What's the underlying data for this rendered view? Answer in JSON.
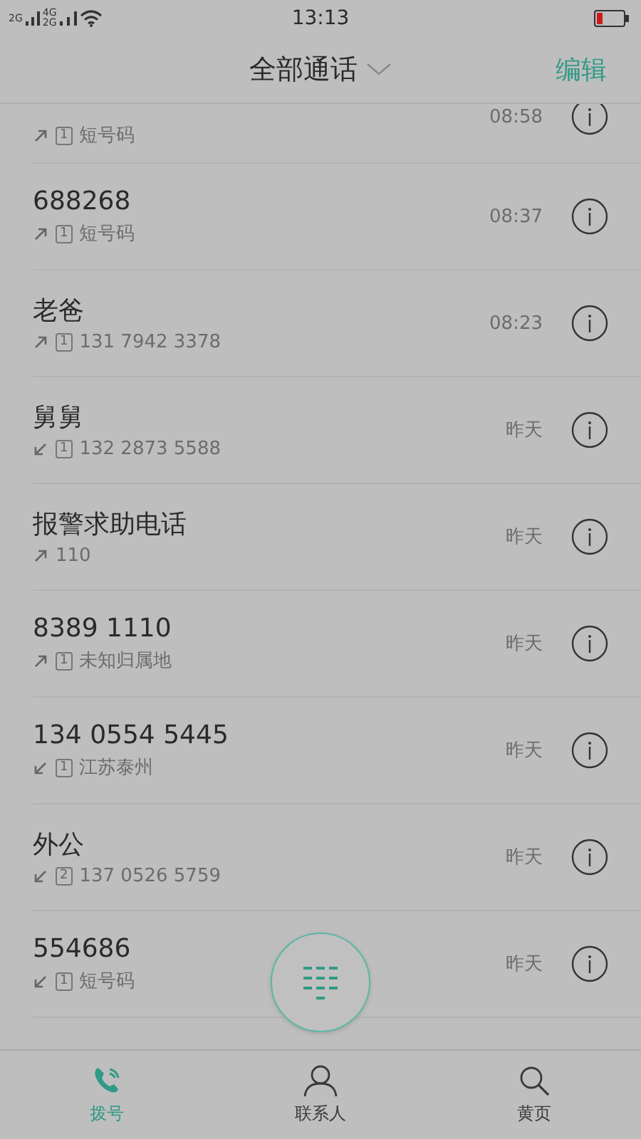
{
  "status_bar": {
    "signal_1": "2G",
    "signal_2_top": "4G",
    "signal_2_bottom": "2G",
    "time": "13:13"
  },
  "header": {
    "title": "全部通话",
    "action": "编辑"
  },
  "calls": [
    {
      "outgoing": true,
      "sim": "1",
      "detail": "短号码",
      "time": "08:58"
    },
    {
      "name": "688268",
      "outgoing": true,
      "sim": "1",
      "detail": "短号码",
      "time": "08:37"
    },
    {
      "name": "老爸",
      "outgoing": true,
      "sim": "1",
      "detail": "131 7942 3378",
      "time": "08:23"
    },
    {
      "name": "舅舅",
      "outgoing": false,
      "sim": "1",
      "detail": "132 2873 5588",
      "time": "昨天"
    },
    {
      "name": "报警求助电话",
      "outgoing": true,
      "detail": "110",
      "time": "昨天"
    },
    {
      "name": "8389 1110",
      "outgoing": true,
      "sim": "1",
      "detail": "未知归属地",
      "time": "昨天"
    },
    {
      "name": "134 0554 5445",
      "outgoing": false,
      "sim": "1",
      "detail": "江苏泰州",
      "time": "昨天"
    },
    {
      "name": "外公",
      "outgoing": false,
      "sim": "2",
      "detail": "137 0526 5759",
      "time": "昨天"
    },
    {
      "name": "554686",
      "outgoing": false,
      "sim": "1",
      "detail": "短号码",
      "time": "昨天"
    }
  ],
  "tabs": [
    {
      "label": "拨号",
      "kind": "dial",
      "selected": true
    },
    {
      "label": "联系人",
      "kind": "contacts",
      "selected": false
    },
    {
      "label": "黄页",
      "kind": "pages",
      "selected": false
    }
  ]
}
